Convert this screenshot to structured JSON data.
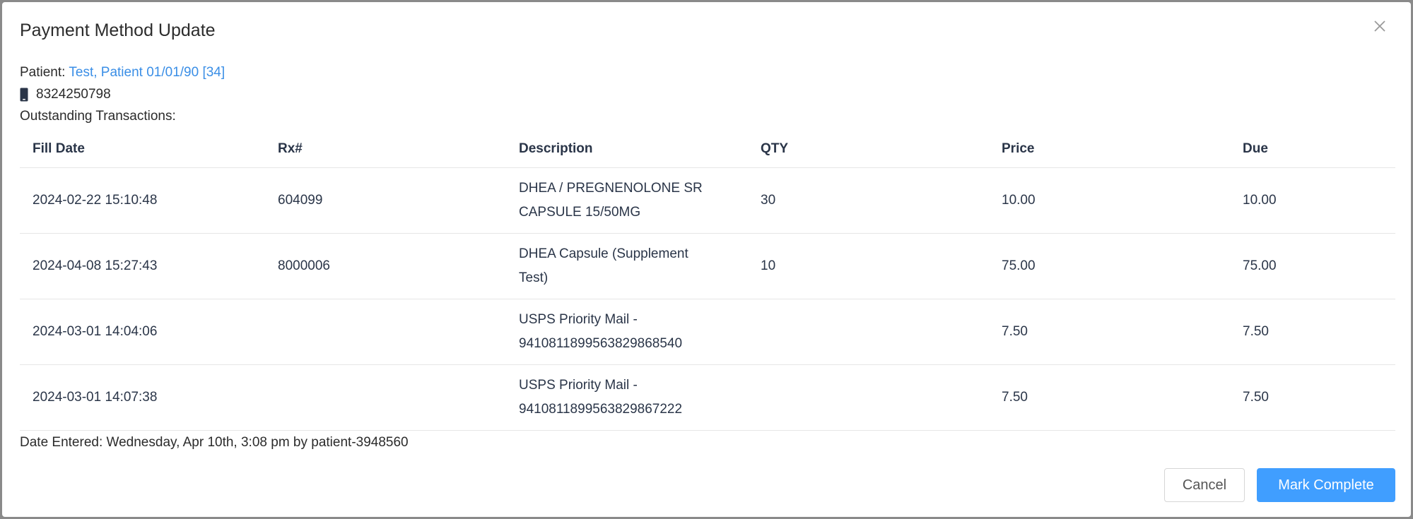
{
  "modal": {
    "title": "Payment Method Update",
    "close_icon": "close-icon"
  },
  "patient": {
    "label": "Patient:",
    "name": "Test, Patient 01/01/90 [34]",
    "phone_icon": "mobile-phone-icon",
    "phone": "8324250798",
    "outstanding_label": "Outstanding Transactions:"
  },
  "table": {
    "headers": {
      "fill_date": "Fill Date",
      "rx": "Rx#",
      "description": "Description",
      "qty": "QTY",
      "price": "Price",
      "due": "Due"
    },
    "rows": [
      {
        "fill_date": "2024-02-22 15:10:48",
        "rx": "604099",
        "description_line1": "DHEA / PREGNENOLONE SR",
        "description_line2": "CAPSULE 15/50MG",
        "qty": "30",
        "price": "10.00",
        "due": "10.00"
      },
      {
        "fill_date": "2024-04-08 15:27:43",
        "rx": "8000006",
        "description_line1": "DHEA Capsule (Supplement",
        "description_line2": "Test)",
        "qty": "10",
        "price": "75.00",
        "due": "75.00"
      },
      {
        "fill_date": "2024-03-01 14:04:06",
        "rx": "",
        "description_line1": "USPS Priority Mail -",
        "description_line2": "9410811899563829868540",
        "qty": "",
        "price": "7.50",
        "due": "7.50"
      },
      {
        "fill_date": "2024-03-01 14:07:38",
        "rx": "",
        "description_line1": "USPS Priority Mail -",
        "description_line2": "9410811899563829867222",
        "qty": "",
        "price": "7.50",
        "due": "7.50"
      }
    ]
  },
  "footer": {
    "date_entered": "Date Entered: Wednesday, Apr 10th, 3:08 pm by patient-3948560",
    "cancel_label": "Cancel",
    "complete_label": "Mark Complete"
  },
  "colors": {
    "link": "#3a8ee6",
    "primary_button": "#409eff",
    "overlay": "#8a8a8a"
  }
}
